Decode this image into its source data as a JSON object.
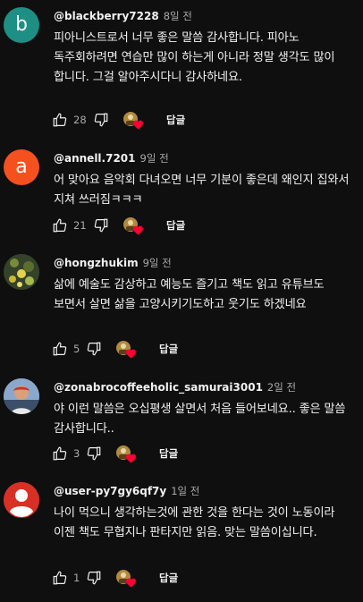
{
  "comments": [
    {
      "author": "@blackberry7228",
      "time": "8일 전",
      "avatar_letter": "b",
      "avatar_color": "#1e8f84",
      "text": "피아니스트로서 너무 좋은 말씀 감사합니다. 피아노 독주회하려면 연습만 많이 하는게 아니라 정말 생각도 많이 합니다. 그걸 알아주시다니 감사하네요.",
      "likes": "28",
      "reply_label": "답글"
    },
    {
      "author": "@annell.7201",
      "time": "9일 전",
      "avatar_letter": "a",
      "avatar_color": "#f4511e",
      "text": "어 맞아요 음악회 다녀오면 너무 기분이 좋은데 왜인지 집와서 지쳐 쓰러짐ㅋㅋㅋ",
      "likes": "21",
      "reply_label": "답글"
    },
    {
      "author": "@hongzhukim",
      "time": "9일 전",
      "text": "삶에 예술도 감상하고 예능도 즐기고 책도 읽고 유튜브도 보면서 살면 삶을 고양시키기도하고 웃기도 하겠네요",
      "likes": "5",
      "reply_label": "답글"
    },
    {
      "author": "@zonabrocoffeeholic_samurai3001",
      "time": "2일 전",
      "text": "야 이런 말씀은 오십평생 살면서 처음 들어보네요.. 좋은 말씀 감사합니다..",
      "likes": "3",
      "reply_label": "답글"
    },
    {
      "author": "@user-py7gy6qf7y",
      "time": "1일 전",
      "avatar_color": "#d93025",
      "text": "나이 먹으니 생각하는것에 관한 것을 한다는 것이 노동이라 이젠 책도 무협지나 판타지만 읽음. 맞는 말씀이십니다.",
      "likes": "1",
      "reply_label": "답글"
    }
  ],
  "icons": {
    "like": "thumbs-up-icon",
    "dislike": "thumbs-down-icon",
    "hearted": "creator-heart-icon"
  },
  "colors": {
    "background": "#0f0f0f",
    "heart": "#ff0033",
    "secondary_text": "#aaaaaa"
  }
}
